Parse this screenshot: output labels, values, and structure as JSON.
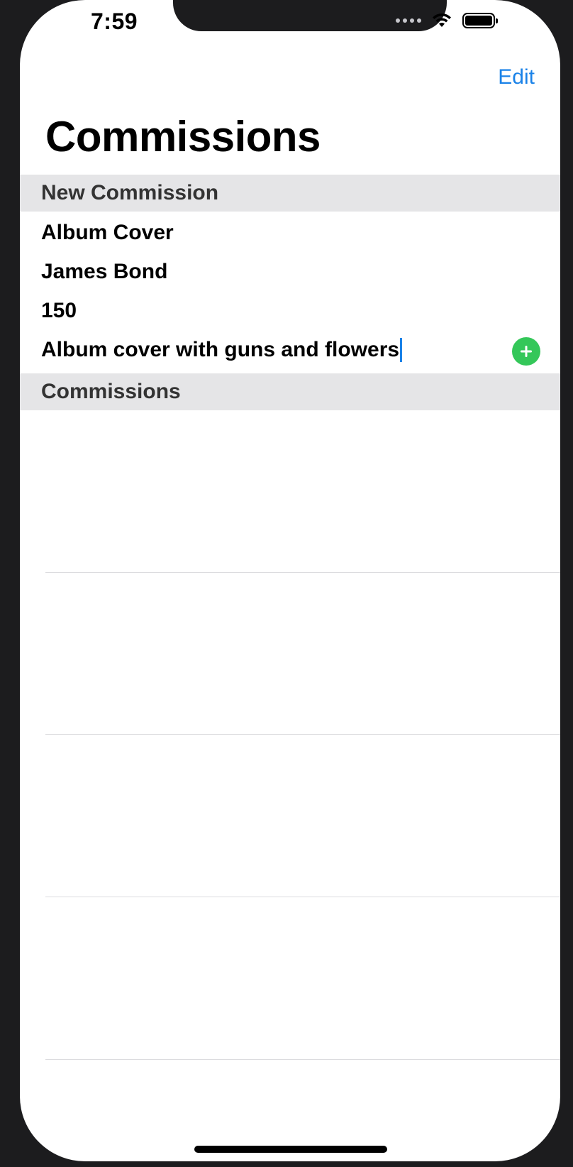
{
  "status_bar": {
    "time": "7:59"
  },
  "nav": {
    "edit_label": "Edit",
    "title": "Commissions"
  },
  "sections": {
    "new_commission_header": "New Commission",
    "commissions_header": "Commissions"
  },
  "form": {
    "title_value": "Album Cover",
    "client_value": "James Bond",
    "price_value": "150",
    "description_value": "Album cover with guns and flowers"
  },
  "icons": {
    "add": "plus-circle-icon"
  },
  "colors": {
    "accent": "#1a82e8",
    "add_button": "#34c759",
    "section_bg": "#e5e5e7"
  }
}
